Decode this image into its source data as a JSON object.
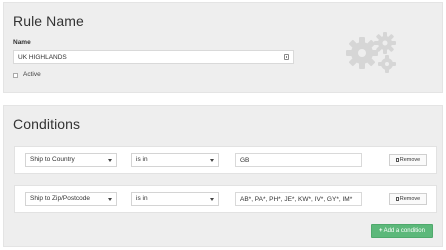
{
  "rule": {
    "title": "Rule Name",
    "name_label": "Name",
    "name_value": "UK HIGHLANDS",
    "active_label": "Active",
    "active_checked": false
  },
  "conditions": {
    "title": "Conditions",
    "rows": [
      {
        "field": "Ship to Country",
        "operator": "is in",
        "value": "GB",
        "remove_label": "Remove"
      },
      {
        "field": "Ship to Zip/Postcode",
        "operator": "is in",
        "value": "AB*, PA*, PH*, JE*, KW*, IV*, GY*, IM*",
        "remove_label": "Remove"
      }
    ],
    "add_label": "Add a condition"
  },
  "colors": {
    "panel_bg": "#eeeeee",
    "add_button": "#5cb87a",
    "gears_icon": "#d6d6d6"
  },
  "icons": [
    "gears-icon",
    "input-card-icon",
    "trash-icon",
    "plus-icon",
    "caret-down-icon"
  ]
}
